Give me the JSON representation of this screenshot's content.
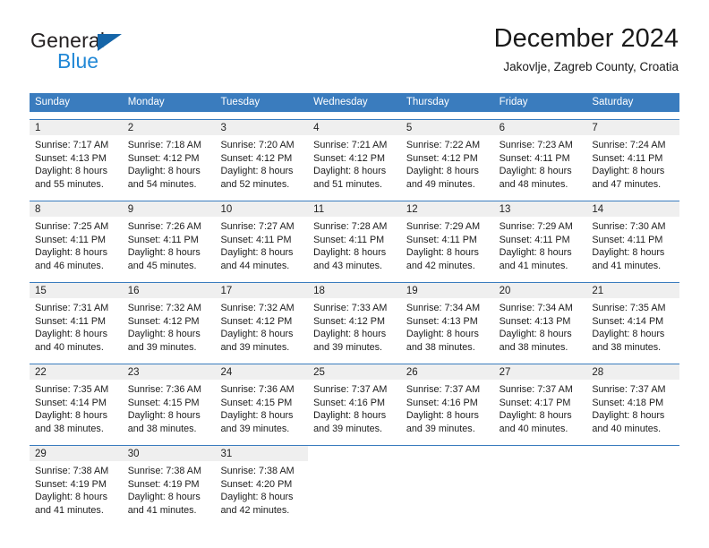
{
  "brand": {
    "name_top": "General",
    "name_bottom": "Blue",
    "accent_color": "#2288d6",
    "triangle_color": "#1565a8"
  },
  "header": {
    "title": "December 2024",
    "subtitle": "Jakovlje, Zagreb County, Croatia"
  },
  "calendar": {
    "header_color": "#3a7cbe",
    "weekdays": [
      "Sunday",
      "Monday",
      "Tuesday",
      "Wednesday",
      "Thursday",
      "Friday",
      "Saturday"
    ],
    "weeks": [
      [
        {
          "day": "1",
          "sunrise": "Sunrise: 7:17 AM",
          "sunset": "Sunset: 4:13 PM",
          "daylight1": "Daylight: 8 hours",
          "daylight2": "and 55 minutes."
        },
        {
          "day": "2",
          "sunrise": "Sunrise: 7:18 AM",
          "sunset": "Sunset: 4:12 PM",
          "daylight1": "Daylight: 8 hours",
          "daylight2": "and 54 minutes."
        },
        {
          "day": "3",
          "sunrise": "Sunrise: 7:20 AM",
          "sunset": "Sunset: 4:12 PM",
          "daylight1": "Daylight: 8 hours",
          "daylight2": "and 52 minutes."
        },
        {
          "day": "4",
          "sunrise": "Sunrise: 7:21 AM",
          "sunset": "Sunset: 4:12 PM",
          "daylight1": "Daylight: 8 hours",
          "daylight2": "and 51 minutes."
        },
        {
          "day": "5",
          "sunrise": "Sunrise: 7:22 AM",
          "sunset": "Sunset: 4:12 PM",
          "daylight1": "Daylight: 8 hours",
          "daylight2": "and 49 minutes."
        },
        {
          "day": "6",
          "sunrise": "Sunrise: 7:23 AM",
          "sunset": "Sunset: 4:11 PM",
          "daylight1": "Daylight: 8 hours",
          "daylight2": "and 48 minutes."
        },
        {
          "day": "7",
          "sunrise": "Sunrise: 7:24 AM",
          "sunset": "Sunset: 4:11 PM",
          "daylight1": "Daylight: 8 hours",
          "daylight2": "and 47 minutes."
        }
      ],
      [
        {
          "day": "8",
          "sunrise": "Sunrise: 7:25 AM",
          "sunset": "Sunset: 4:11 PM",
          "daylight1": "Daylight: 8 hours",
          "daylight2": "and 46 minutes."
        },
        {
          "day": "9",
          "sunrise": "Sunrise: 7:26 AM",
          "sunset": "Sunset: 4:11 PM",
          "daylight1": "Daylight: 8 hours",
          "daylight2": "and 45 minutes."
        },
        {
          "day": "10",
          "sunrise": "Sunrise: 7:27 AM",
          "sunset": "Sunset: 4:11 PM",
          "daylight1": "Daylight: 8 hours",
          "daylight2": "and 44 minutes."
        },
        {
          "day": "11",
          "sunrise": "Sunrise: 7:28 AM",
          "sunset": "Sunset: 4:11 PM",
          "daylight1": "Daylight: 8 hours",
          "daylight2": "and 43 minutes."
        },
        {
          "day": "12",
          "sunrise": "Sunrise: 7:29 AM",
          "sunset": "Sunset: 4:11 PM",
          "daylight1": "Daylight: 8 hours",
          "daylight2": "and 42 minutes."
        },
        {
          "day": "13",
          "sunrise": "Sunrise: 7:29 AM",
          "sunset": "Sunset: 4:11 PM",
          "daylight1": "Daylight: 8 hours",
          "daylight2": "and 41 minutes."
        },
        {
          "day": "14",
          "sunrise": "Sunrise: 7:30 AM",
          "sunset": "Sunset: 4:11 PM",
          "daylight1": "Daylight: 8 hours",
          "daylight2": "and 41 minutes."
        }
      ],
      [
        {
          "day": "15",
          "sunrise": "Sunrise: 7:31 AM",
          "sunset": "Sunset: 4:11 PM",
          "daylight1": "Daylight: 8 hours",
          "daylight2": "and 40 minutes."
        },
        {
          "day": "16",
          "sunrise": "Sunrise: 7:32 AM",
          "sunset": "Sunset: 4:12 PM",
          "daylight1": "Daylight: 8 hours",
          "daylight2": "and 39 minutes."
        },
        {
          "day": "17",
          "sunrise": "Sunrise: 7:32 AM",
          "sunset": "Sunset: 4:12 PM",
          "daylight1": "Daylight: 8 hours",
          "daylight2": "and 39 minutes."
        },
        {
          "day": "18",
          "sunrise": "Sunrise: 7:33 AM",
          "sunset": "Sunset: 4:12 PM",
          "daylight1": "Daylight: 8 hours",
          "daylight2": "and 39 minutes."
        },
        {
          "day": "19",
          "sunrise": "Sunrise: 7:34 AM",
          "sunset": "Sunset: 4:13 PM",
          "daylight1": "Daylight: 8 hours",
          "daylight2": "and 38 minutes."
        },
        {
          "day": "20",
          "sunrise": "Sunrise: 7:34 AM",
          "sunset": "Sunset: 4:13 PM",
          "daylight1": "Daylight: 8 hours",
          "daylight2": "and 38 minutes."
        },
        {
          "day": "21",
          "sunrise": "Sunrise: 7:35 AM",
          "sunset": "Sunset: 4:14 PM",
          "daylight1": "Daylight: 8 hours",
          "daylight2": "and 38 minutes."
        }
      ],
      [
        {
          "day": "22",
          "sunrise": "Sunrise: 7:35 AM",
          "sunset": "Sunset: 4:14 PM",
          "daylight1": "Daylight: 8 hours",
          "daylight2": "and 38 minutes."
        },
        {
          "day": "23",
          "sunrise": "Sunrise: 7:36 AM",
          "sunset": "Sunset: 4:15 PM",
          "daylight1": "Daylight: 8 hours",
          "daylight2": "and 38 minutes."
        },
        {
          "day": "24",
          "sunrise": "Sunrise: 7:36 AM",
          "sunset": "Sunset: 4:15 PM",
          "daylight1": "Daylight: 8 hours",
          "daylight2": "and 39 minutes."
        },
        {
          "day": "25",
          "sunrise": "Sunrise: 7:37 AM",
          "sunset": "Sunset: 4:16 PM",
          "daylight1": "Daylight: 8 hours",
          "daylight2": "and 39 minutes."
        },
        {
          "day": "26",
          "sunrise": "Sunrise: 7:37 AM",
          "sunset": "Sunset: 4:16 PM",
          "daylight1": "Daylight: 8 hours",
          "daylight2": "and 39 minutes."
        },
        {
          "day": "27",
          "sunrise": "Sunrise: 7:37 AM",
          "sunset": "Sunset: 4:17 PM",
          "daylight1": "Daylight: 8 hours",
          "daylight2": "and 40 minutes."
        },
        {
          "day": "28",
          "sunrise": "Sunrise: 7:37 AM",
          "sunset": "Sunset: 4:18 PM",
          "daylight1": "Daylight: 8 hours",
          "daylight2": "and 40 minutes."
        }
      ],
      [
        {
          "day": "29",
          "sunrise": "Sunrise: 7:38 AM",
          "sunset": "Sunset: 4:19 PM",
          "daylight1": "Daylight: 8 hours",
          "daylight2": "and 41 minutes."
        },
        {
          "day": "30",
          "sunrise": "Sunrise: 7:38 AM",
          "sunset": "Sunset: 4:19 PM",
          "daylight1": "Daylight: 8 hours",
          "daylight2": "and 41 minutes."
        },
        {
          "day": "31",
          "sunrise": "Sunrise: 7:38 AM",
          "sunset": "Sunset: 4:20 PM",
          "daylight1": "Daylight: 8 hours",
          "daylight2": "and 42 minutes."
        },
        {
          "day": "",
          "sunrise": "",
          "sunset": "",
          "daylight1": "",
          "daylight2": ""
        },
        {
          "day": "",
          "sunrise": "",
          "sunset": "",
          "daylight1": "",
          "daylight2": ""
        },
        {
          "day": "",
          "sunrise": "",
          "sunset": "",
          "daylight1": "",
          "daylight2": ""
        },
        {
          "day": "",
          "sunrise": "",
          "sunset": "",
          "daylight1": "",
          "daylight2": ""
        }
      ]
    ]
  }
}
